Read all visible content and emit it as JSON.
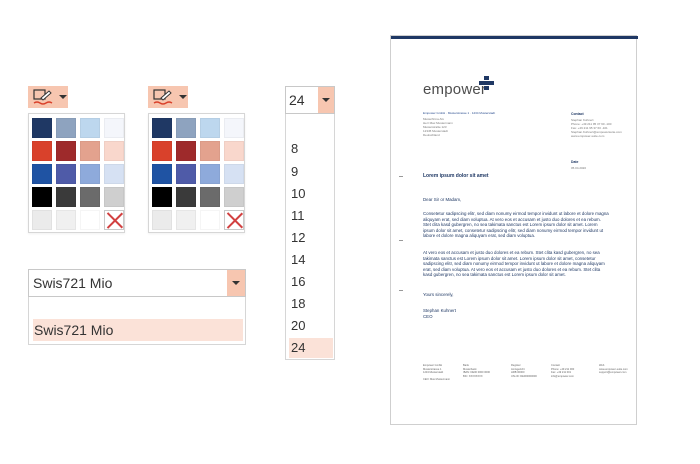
{
  "color_picker": {
    "left": {
      "icon": "pen-icon"
    },
    "right": {
      "icon": "pen-icon"
    },
    "swatches": [
      "#1f3864",
      "#8ea3bf",
      "#bdd7ee",
      "#f4f6fb",
      "#d9412b",
      "#9e2a2b",
      "#e3a28e",
      "#f9d7cc",
      "#1f53a3",
      "#4f5ba8",
      "#8eaadb",
      "#d6e1f3",
      "#000000",
      "#3a3a3a",
      "#6b6b6b",
      "#cfcfcf",
      "#ebebeb",
      "#f0f0f0",
      "#ffffff",
      "none"
    ]
  },
  "font_dropdown": {
    "value": "Swis721 Mio",
    "options": [
      "Swis721 Mio"
    ]
  },
  "size_dropdown": {
    "value": "24",
    "options": [
      "8",
      "9",
      "10",
      "11",
      "12",
      "14",
      "16",
      "18",
      "20",
      "24"
    ]
  },
  "letter": {
    "logo": "empower",
    "sender_line": "Empower GmbH · Musterstrasse 1 · 1234 Musterstadt",
    "recipient": "Musterfirma AG\nHerr Max Mustermann\nMusterstraße 123\n12345 Musterstadt\nDeutschland",
    "contact_label": "Contact",
    "contact": "Stephan Kuhnert\nPhone: +49 211 95 37 60 -100\nFax: +49 211 95 37 60 -101\nStephan.Kuhnert@empowersuite.com\nwww.empower-suite.com",
    "date_label": "Date",
    "date": "05.04.2020",
    "subject": "Lorem ipsum dolor sit amet",
    "salutation": "Dear Sir or Madam,",
    "para1": "Consetetur sadipscing elitr, sed diam nonumy eirmod tempor invidunt ut labore et dolore magna aliquyam erat, sed diam voluptua. At vero eos et accusam et justo duo dolores et ea rebum. Stet clita kasd gubergren, no sea takimata sanctus est Lorem ipsum dolor sit amet. Lorem ipsum dolor sit amet, consetetur sadipscing elitr, sed diam nonumy eirmod tempor invidunt ut labore et dolore magna aliquyam erat, sed diam voluptua.",
    "para2": "At vero eos et accusam et justo duo dolores et ea rebum. Stet clita kasd gubergren, no sea takimata sanctus est Lorem ipsum dolor sit amet. Lorem ipsum dolor sit amet, consetetur sadipscing elitr, sed diam nonumy eirmod tempor invidunt ut labore et dolore magna aliquyam erat, sed diam voluptua. At vero eos et accusam et justo duo dolores et ea rebum. Stet clita kasd gubergren, no sea takimata sanctus est Lorem ipsum dolor sit amet.",
    "closing": "Yours sincerely,",
    "signer": "Stephan Kuhnert\nCEO",
    "footer": [
      "Empower GmbH\nMusterstrasse 1\n1234 Musterstadt\n\nCEO: Max Mustermann",
      "Bank\nMusterbank\nIBAN: DE00 0000 0000\nBIC: XXXXXXXX",
      "Register\nAmtsgericht\nHRB 00000\nUSt-ID: DE000000000",
      "Contact\nPhone: +49 211 000\nFax: +49 211 001\ninfo@empower.com",
      "Web\nwww.empower-suite.com\nsupport@empower.com"
    ]
  }
}
